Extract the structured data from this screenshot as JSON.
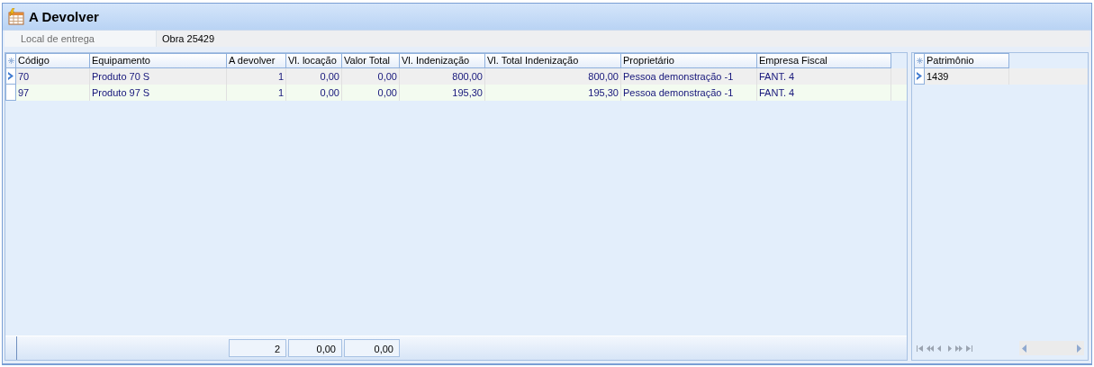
{
  "title": "A Devolver",
  "delivery": {
    "label": "Local de entrega",
    "value": "Obra 25429"
  },
  "grid": {
    "columns": [
      {
        "label": "Código",
        "kind": "text"
      },
      {
        "label": "Equipamento",
        "kind": "text"
      },
      {
        "label": "A devolver",
        "kind": "number",
        "total": "2"
      },
      {
        "label": "Vl. locação",
        "kind": "number",
        "total": "0,00"
      },
      {
        "label": "Valor Total",
        "kind": "number",
        "total": "0,00"
      },
      {
        "label": "Vl. Indenização",
        "kind": "number"
      },
      {
        "label": "Vl. Total Indenização",
        "kind": "number"
      },
      {
        "label": "Proprietário",
        "kind": "text"
      },
      {
        "label": "Empresa Fiscal",
        "kind": "text"
      }
    ],
    "rows": [
      {
        "selected": true,
        "cells": [
          "70",
          "Produto 70 S",
          "1",
          "0,00",
          "0,00",
          "800,00",
          "800,00",
          "Pessoa demonstração -1",
          "FANT. 4"
        ]
      },
      {
        "selected": false,
        "cells": [
          "97",
          "Produto 97 S",
          "1",
          "0,00",
          "0,00",
          "195,30",
          "195,30",
          "Pessoa demonstração -1",
          "FANT. 4"
        ]
      }
    ]
  },
  "patrimonio": {
    "column": "Patrimônio",
    "rows": [
      {
        "selected": true,
        "value": "1439"
      }
    ]
  }
}
